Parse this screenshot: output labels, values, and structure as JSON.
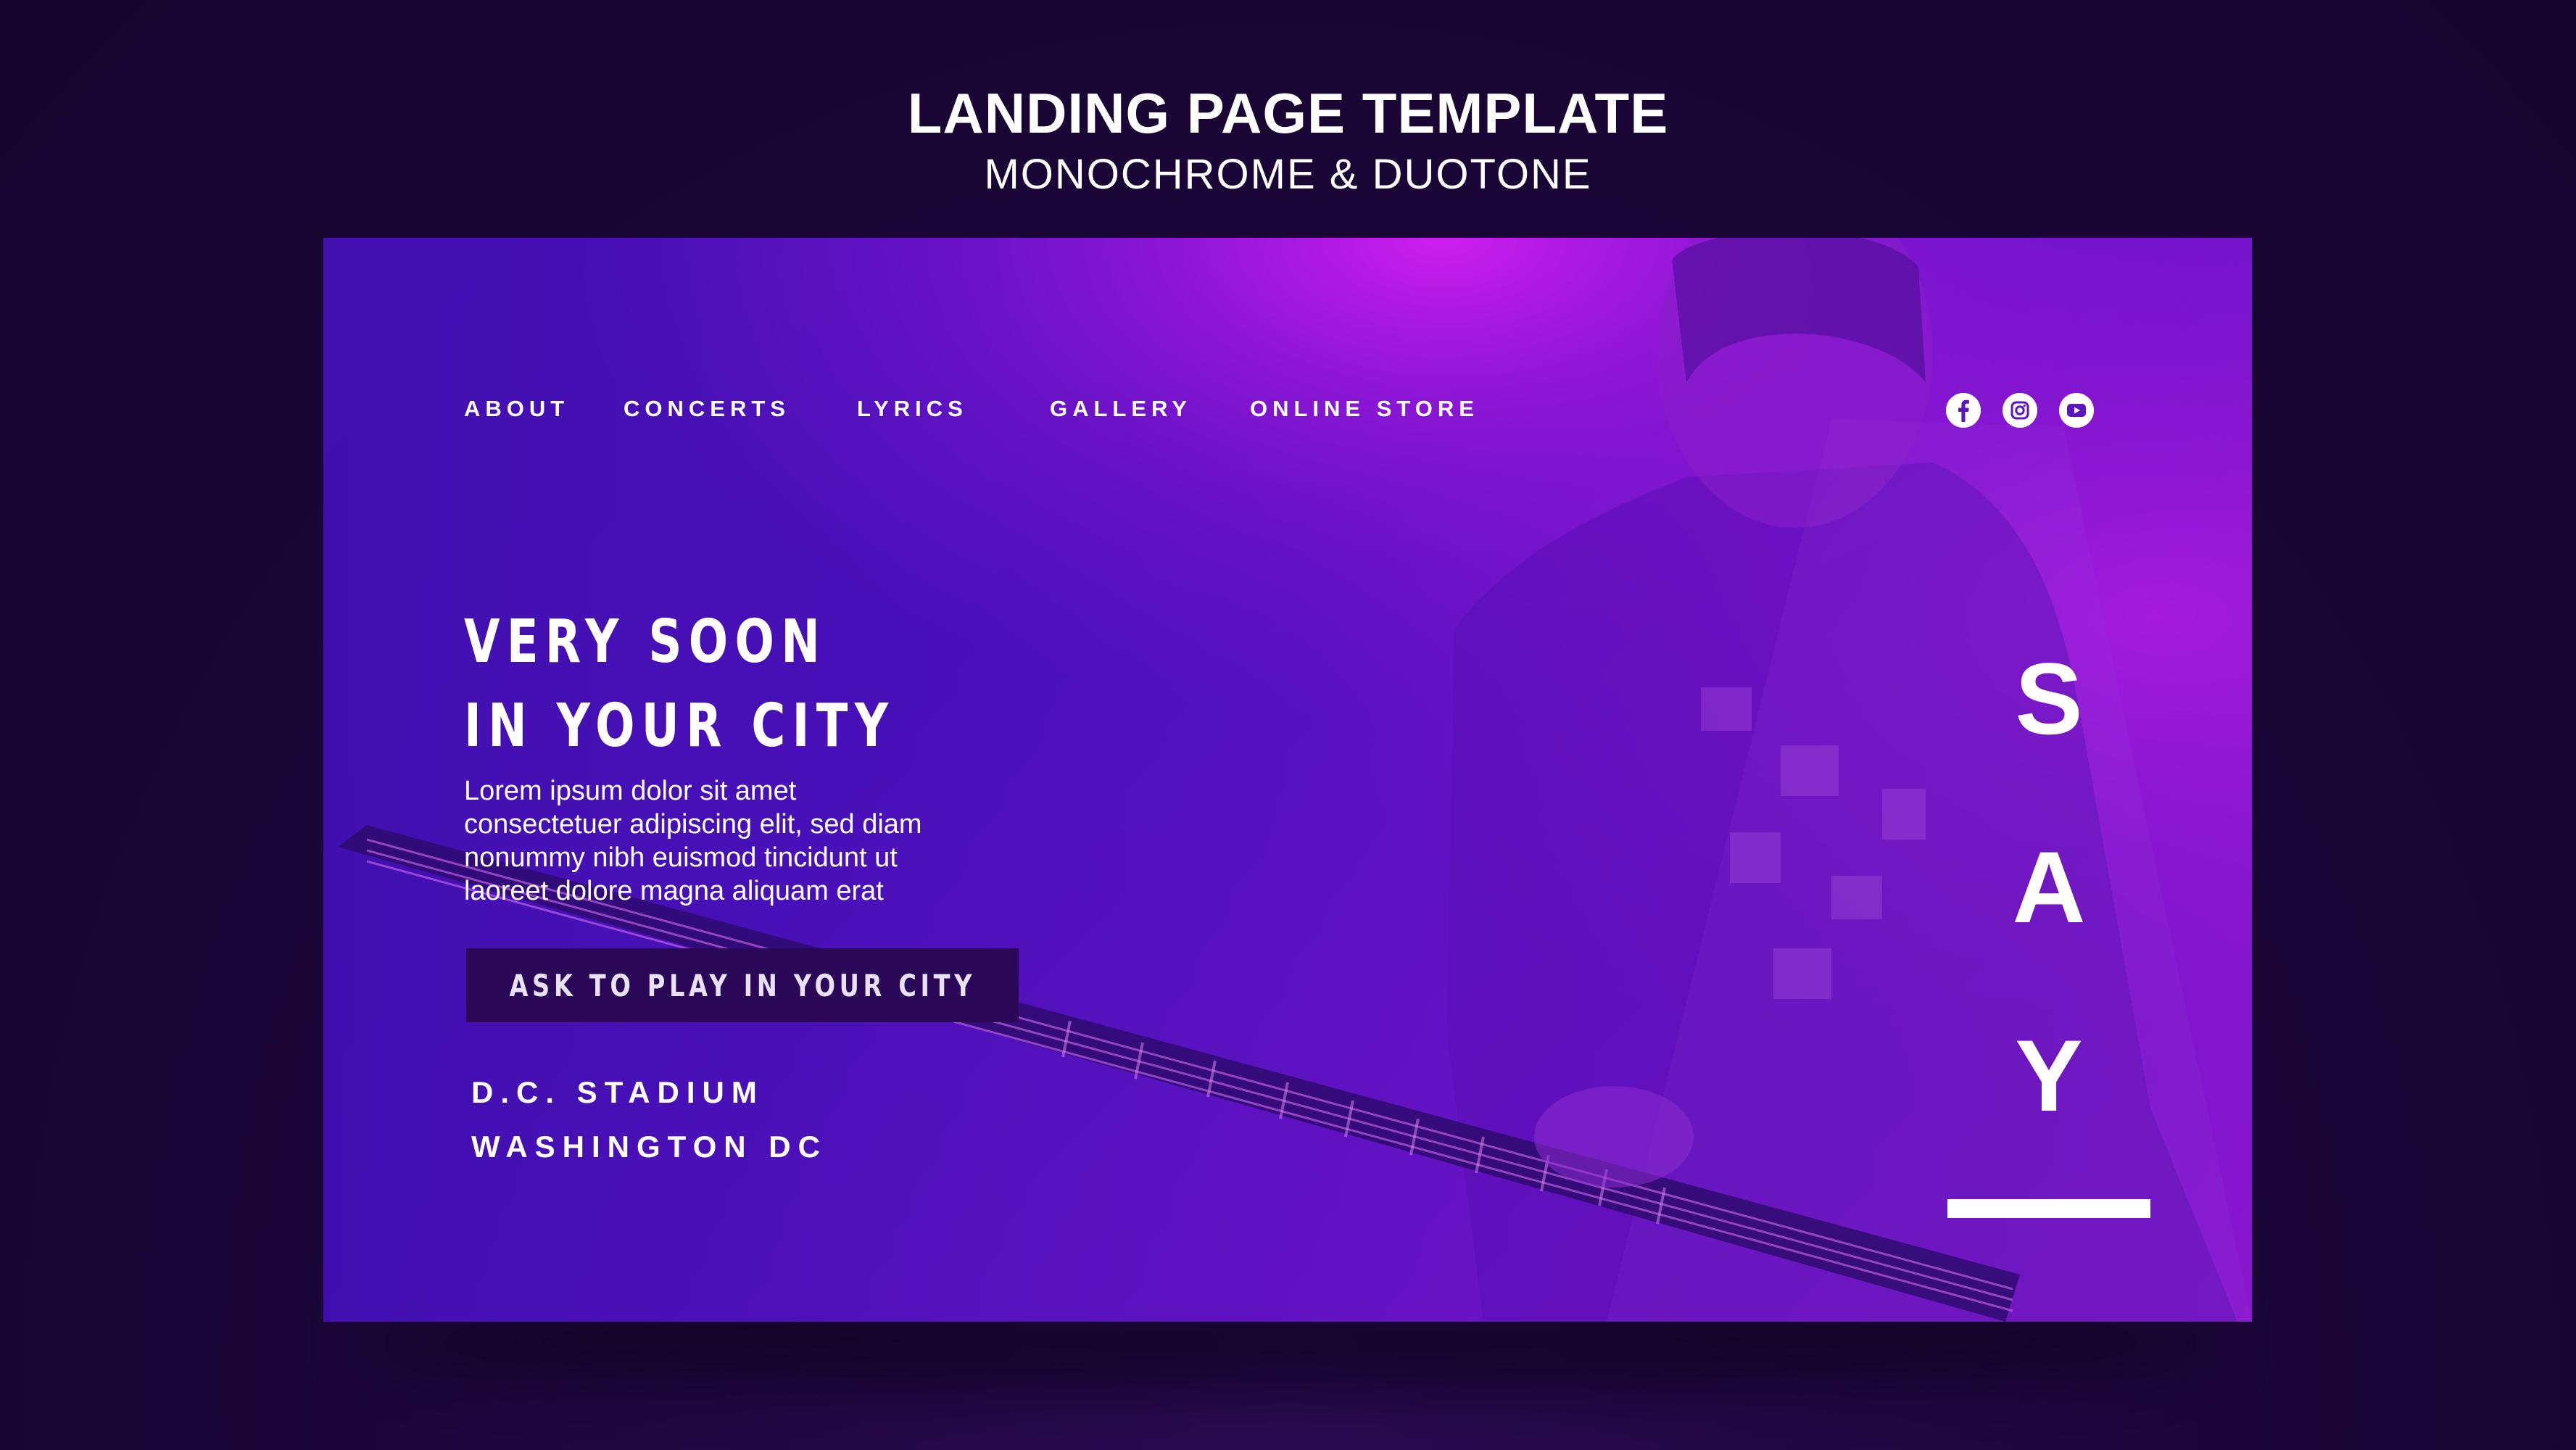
{
  "header": {
    "title": "LANDING PAGE TEMPLATE",
    "subtitle": "MONOCHROME & DUOTONE"
  },
  "nav": {
    "items": [
      {
        "label": "ABOUT"
      },
      {
        "label": "CONCERTS"
      },
      {
        "label": "LYRICS"
      },
      {
        "label": "GALLERY"
      },
      {
        "label": "ONLINE STORE"
      }
    ]
  },
  "socials": {
    "icons": [
      "facebook-icon",
      "instagram-icon",
      "youtube-icon"
    ]
  },
  "hero": {
    "title_line1": "VERY SOON",
    "title_line2": "IN YOUR CITY",
    "body_lines": [
      "Lorem ipsum dolor sit amet",
      "consectetuer adipiscing elit, sed diam",
      "nonummy nibh euismod tincidunt ut",
      "laoreet dolore magna aliquam erat"
    ],
    "cta_label": "ASK TO PLAY IN YOUR CITY",
    "venue_line1": "D.C. STADIUM",
    "venue_line2": "WASHINGTON DC"
  },
  "brand": {
    "letters": [
      "S",
      "A",
      "Y"
    ]
  },
  "colors": {
    "page_background": "#1b0637",
    "card_primary": "#4d0fc0",
    "card_highlight": "#c51de8",
    "button_background": "#2b0757",
    "text": "#ffffff"
  }
}
